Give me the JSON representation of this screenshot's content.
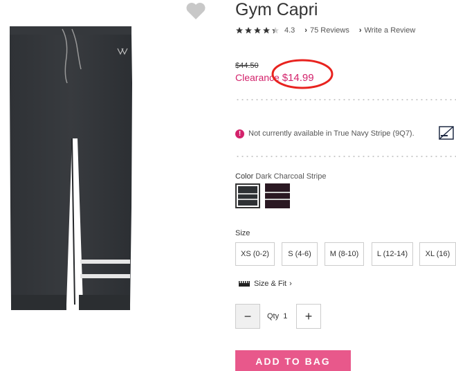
{
  "product": {
    "title": "Gym Capri",
    "rating_value": "4.3",
    "rating_stars": 4.3,
    "reviews_link": "75 Reviews",
    "write_review_link": "Write a Review"
  },
  "price": {
    "original": "$44.50",
    "sale_prefix": "Clearance ",
    "sale_amount": "$14.99"
  },
  "notice": {
    "text": "Not currently available in True Navy Stripe (9Q7)."
  },
  "color": {
    "label": "Color",
    "selected": "Dark Charcoal Stripe",
    "swatches": [
      "#2e3134",
      "#2a1822"
    ]
  },
  "size": {
    "label": "Size",
    "options": [
      "XS (0-2)",
      "S (4-6)",
      "M (8-10)",
      "L (12-14)",
      "XL (16)"
    ]
  },
  "size_fit": {
    "label": "Size & Fit"
  },
  "quantity": {
    "label": "Qty",
    "value": "1",
    "minus": "−",
    "plus": "+"
  },
  "cta": {
    "add_to_bag": "ADD TO BAG"
  },
  "icons": {
    "wishlist": "heart-icon",
    "alert": "alert-icon",
    "ruler": "ruler-icon",
    "chevron": "chevron-right-icon"
  },
  "colors": {
    "accent": "#d3226b",
    "cta": "#e8588b",
    "annotation": "#e8231f"
  }
}
